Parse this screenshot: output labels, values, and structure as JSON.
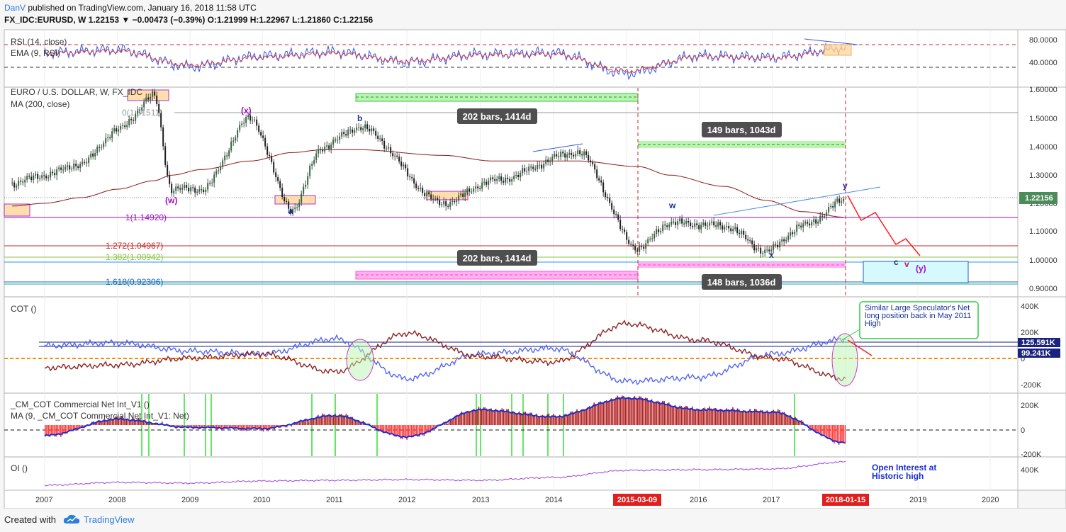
{
  "header": {
    "author": "DanV",
    "published_text": "published on TradingView.com, January 16, 2018 11:58 UTC",
    "symbol_line": "FX_IDC:EURUSD, W  1.22153  ▼ −0.00473 (−0.39%)  O:1.21999  H:1.22967  L:1.21860  C:1.22156"
  },
  "footer": {
    "created_with": "Created with",
    "brand": "TradingView"
  },
  "panes": {
    "rsi": {
      "title": "RSI (14, close)",
      "ema": "EMA (9, RSI)",
      "ticks": [
        "80.0000",
        "40.0000"
      ]
    },
    "price": {
      "title": "EURO / U.S. DOLLAR, W, FX_IDC",
      "ma": "MA (200, close)",
      "ticks": [
        "1.60000",
        "1.50000",
        "1.40000",
        "1.30000",
        "1.20000",
        "1.10000",
        "1.00000",
        "0.90000"
      ],
      "last_price": "1.22156"
    },
    "cot": {
      "title": "COT ()",
      "ticks": [
        "400K",
        "200K",
        "0",
        "-200K"
      ],
      "badge_blue": "125.591K",
      "badge_orange": "99.241K"
    },
    "cm": {
      "title": "_CM_COT Commercial Net Int_V1 ()",
      "ma": "MA (9, _CM_COT Commercial Net Int_V1: Net)",
      "ticks": [
        "200K",
        "0",
        "-200K"
      ]
    },
    "oi": {
      "title": "OI ()",
      "ticks": [
        "400K"
      ]
    }
  },
  "annotations": {
    "fib_0": "0(1.51511)",
    "fib_1": "1(1.14920)",
    "fib_1272": "1.272(1.04967)",
    "fib_1382": "1.382(1.00942)",
    "fib_1618": "1.618(0.92306)",
    "bars_top_left": "202 bars, 1414d",
    "bars_top_right": "149 bars, 1043d",
    "bars_bottom_left": "202 bars, 1414d",
    "bars_bottom_right": "148 bars, 1036d",
    "wave_w_paren": "(w)",
    "wave_x_paren": "(x)",
    "wave_y_paren": "(y)",
    "wave_a": "a",
    "wave_b": "b",
    "wave_c": "c",
    "wave_w": "w",
    "wave_x": "x",
    "wave_y": "y",
    "wave_v": "v",
    "cot_note": "Similar Large Speculator's Net long position back in May 2011 High",
    "oi_note": "Open Interest at Historic high"
  },
  "time_axis": {
    "labels": [
      "2007",
      "2008",
      "2009",
      "2010",
      "2011",
      "2012",
      "2013",
      "2014",
      "2015-03-09",
      "2016",
      "2017",
      "2018-01-15",
      "2019",
      "2020"
    ]
  },
  "colors": {
    "price_up": "#2f6b3f",
    "price_down": "#1f1f1f",
    "rsi": "#3355ee",
    "rsi_ema": "#e04040",
    "ma200": "#8b1a1a",
    "cot_blue": "#5566ee",
    "cot_red": "#8b2222",
    "hist_up": "#b22222",
    "hist_down": "#ff3b3b",
    "cm_ma": "#1a2ed6",
    "oi": "#a040e0",
    "highlight_date": "#e0201e",
    "green_bar": "#33dd33",
    "projection": "#ff1a1a"
  },
  "chart_data": [
    {
      "type": "line",
      "title": "RSI (14, close)",
      "x": [
        "2007",
        "2008",
        "2009",
        "2010",
        "2011",
        "2012",
        "2013",
        "2014",
        "2015",
        "2016",
        "2017",
        "2018-01"
      ],
      "series": [
        {
          "name": "RSI (14, close)",
          "values": [
            62,
            66,
            44,
            58,
            63,
            50,
            60,
            62,
            35,
            58,
            56,
            68
          ]
        },
        {
          "name": "EMA (9, RSI)",
          "values": [
            61,
            64,
            46,
            56,
            61,
            51,
            59,
            60,
            38,
            57,
            55,
            67
          ]
        }
      ],
      "ylim": [
        20,
        90
      ]
    },
    {
      "type": "line",
      "title": "EURO / U.S. DOLLAR, W, FX_IDC",
      "x": [
        "2006-08",
        "2007-01",
        "2007-07",
        "2008-01",
        "2008-07",
        "2008-10",
        "2009-03",
        "2009-11",
        "2010-06",
        "2010-11",
        "2011-05",
        "2012-07",
        "2013-03",
        "2014-05",
        "2015-03",
        "2015-08",
        "2016-05",
        "2016-12",
        "2017-06",
        "2018-01"
      ],
      "series": [
        {
          "name": "EURUSD",
          "values": [
            1.28,
            1.31,
            1.35,
            1.47,
            1.59,
            1.26,
            1.26,
            1.51,
            1.19,
            1.41,
            1.48,
            1.21,
            1.29,
            1.39,
            1.05,
            1.14,
            1.13,
            1.04,
            1.13,
            1.22
          ]
        },
        {
          "name": "MA (200, close)",
          "values": [
            1.2,
            1.21,
            1.23,
            1.26,
            1.29,
            1.31,
            1.33,
            1.36,
            1.39,
            1.4,
            1.4,
            1.38,
            1.36,
            1.36,
            1.34,
            1.31,
            1.27,
            1.22,
            1.18,
            1.16
          ]
        }
      ],
      "ylim": [
        0.88,
        1.62
      ]
    },
    {
      "type": "line",
      "title": "COT ()",
      "x": [
        "2007",
        "2008",
        "2009",
        "2010",
        "2011",
        "2012",
        "2013",
        "2014",
        "2015",
        "2016",
        "2017",
        "2018-01"
      ],
      "series": [
        {
          "values": [
            80,
            100,
            40,
            20,
            130,
            -160,
            20,
            60,
            -180,
            -150,
            20,
            126
          ]
        },
        {
          "values": [
            -80,
            -60,
            -10,
            20,
            -110,
            170,
            0,
            -40,
            240,
            120,
            -10,
            -160
          ]
        }
      ],
      "ylim": [
        -250,
        420
      ]
    },
    {
      "type": "bar",
      "title": "_CM_COT Commercial Net Int_V1 ()",
      "x": [
        "2007",
        "2008",
        "2009",
        "2010",
        "2011",
        "2012",
        "2013",
        "2014",
        "2015",
        "2016",
        "2017",
        "2018-01"
      ],
      "series": [
        {
          "name": "Net",
          "values": [
            -100,
            60,
            -20,
            -40,
            90,
            -110,
            140,
            80,
            240,
            140,
            120,
            -160
          ]
        },
        {
          "name": "MA (9, _CM_COT Commercial Net Int_V1: Net)",
          "values": [
            -90,
            50,
            -20,
            -30,
            80,
            -100,
            130,
            70,
            230,
            130,
            110,
            -150
          ]
        }
      ],
      "ylim": [
        -260,
        260
      ]
    },
    {
      "type": "line",
      "title": "OI ()",
      "x": [
        "2007",
        "2008",
        "2009",
        "2010",
        "2011",
        "2012",
        "2013",
        "2014",
        "2015",
        "2016",
        "2017",
        "2018-01"
      ],
      "series": [
        {
          "values": [
            150,
            190,
            180,
            210,
            220,
            230,
            220,
            260,
            360,
            370,
            380,
            480
          ]
        }
      ],
      "ylim": [
        100,
        520
      ]
    }
  ]
}
